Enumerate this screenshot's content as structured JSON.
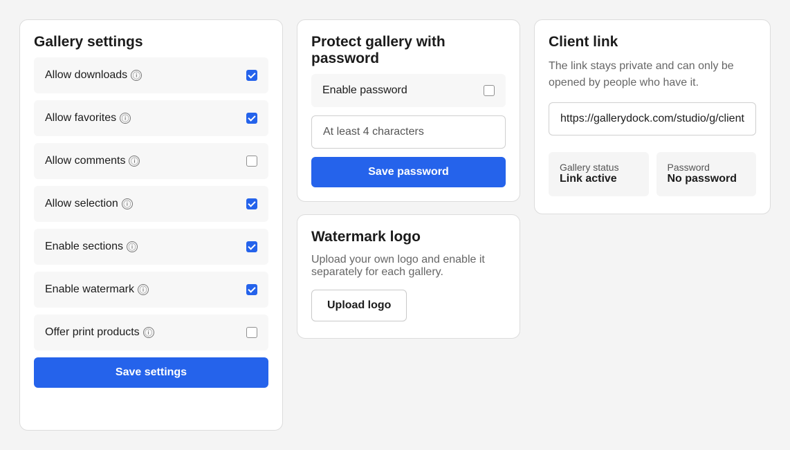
{
  "gallery_settings": {
    "title": "Gallery settings",
    "info_glyph": "ⓘ",
    "items": [
      {
        "label": "Allow downloads",
        "checked": true
      },
      {
        "label": "Allow favorites",
        "checked": true
      },
      {
        "label": "Allow comments",
        "checked": false
      },
      {
        "label": "Allow selection",
        "checked": true
      },
      {
        "label": "Enable sections",
        "checked": true
      },
      {
        "label": "Enable watermark",
        "checked": true
      },
      {
        "label": "Offer print products",
        "checked": false
      }
    ],
    "save_label": "Save settings"
  },
  "password": {
    "title": "Protect gallery with password",
    "toggle_label": "Enable password",
    "toggle_checked": false,
    "input_value": "",
    "input_placeholder": "At least 4 characters",
    "save_label": "Save password"
  },
  "watermark": {
    "title": "Watermark logo",
    "description": "Upload your own logo and enable it separately for each gallery.",
    "upload_label": "Upload logo"
  },
  "client_link": {
    "title": "Client link",
    "description": "The link stays private and can only be opened by people who have it.",
    "url": "https://gallerydock.com/studio/g/client",
    "status_label": "Gallery status",
    "status_value": "Link active",
    "password_label": "Password",
    "password_value": "No password"
  },
  "colors": {
    "accent": "#2563eb",
    "background": "#f4f4f4",
    "card": "#ffffff"
  }
}
